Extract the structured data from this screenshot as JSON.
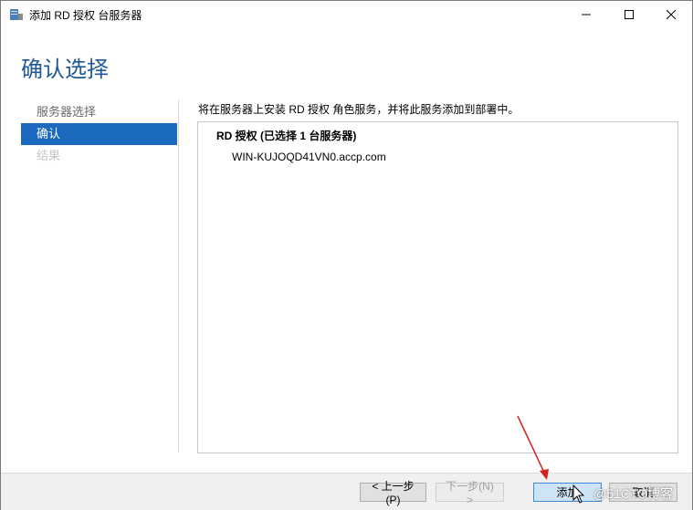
{
  "window": {
    "title": "添加 RD 授权 台服务器",
    "controls": {
      "minimize": "—",
      "maximize": "☐",
      "close": "✕"
    }
  },
  "heading": "确认选择",
  "nav": {
    "items": [
      {
        "label": "服务器选择",
        "state": "normal"
      },
      {
        "label": "确认",
        "state": "active"
      },
      {
        "label": "结果",
        "state": "disabled"
      }
    ]
  },
  "main": {
    "description": "将在服务器上安装 RD 授权 角色服务，并将此服务添加到部署中。",
    "role_title": "RD 授权 (已选择 1 台服务器)",
    "server": "WIN-KUJOQD41VN0.accp.com"
  },
  "footer": {
    "prev_label": "< 上一步(P)",
    "next_label": "下一步(N) >",
    "add_label": "添加",
    "cancel_label": "取消"
  },
  "watermark": "@51CTO博客",
  "colors": {
    "accent": "#1c6ac0",
    "heading": "#1e5a96",
    "annotation_arrow": "#d42020"
  }
}
